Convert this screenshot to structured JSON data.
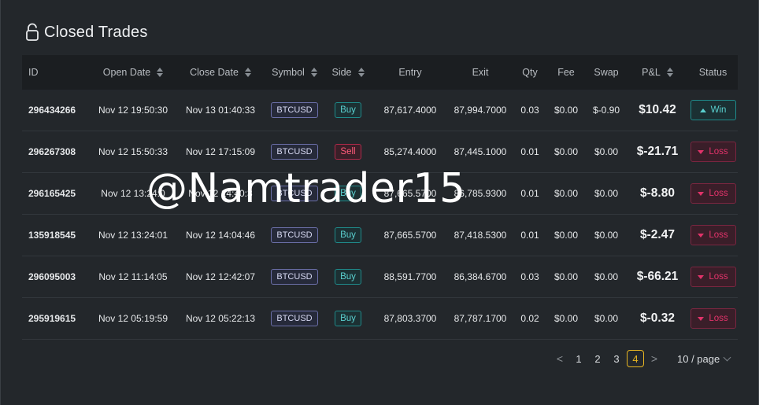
{
  "header": {
    "title": "Closed Trades",
    "icon": "lock-icon"
  },
  "table": {
    "columns": {
      "id": "ID",
      "open_date": "Open Date",
      "close_date": "Close Date",
      "symbol": "Symbol",
      "side": "Side",
      "entry": "Entry",
      "exit": "Exit",
      "qty": "Qty",
      "fee": "Fee",
      "swap": "Swap",
      "pnl": "P&L",
      "status": "Status"
    },
    "rows": [
      {
        "id": "296434266",
        "open_date": "Nov 12 19:50:30",
        "close_date": "Nov 13 01:40:33",
        "symbol": "BTCUSD",
        "side": "Buy",
        "entry": "87,617.4000",
        "exit": "87,994.7000",
        "qty": "0.03",
        "fee": "$0.00",
        "swap": "$-0.90",
        "pnl": "$10.42",
        "status": "Win"
      },
      {
        "id": "296267308",
        "open_date": "Nov 12 15:50:33",
        "close_date": "Nov 12 17:15:09",
        "symbol": "BTCUSD",
        "side": "Sell",
        "entry": "85,274.4000",
        "exit": "87,445.1000",
        "qty": "0.01",
        "fee": "$0.00",
        "swap": "$0.00",
        "pnl": "$-21.71",
        "status": "Loss"
      },
      {
        "id": "296165425",
        "open_date": "Nov 12 13:24:0",
        "close_date": "Nov 12 14:40:3",
        "symbol": "BTCUSD",
        "side": "Buy",
        "entry": "87,665.5700",
        "exit": "86,785.9300",
        "qty": "0.01",
        "fee": "$0.00",
        "swap": "$0.00",
        "pnl": "$-8.80",
        "status": "Loss"
      },
      {
        "id": "135918545",
        "open_date": "Nov 12 13:24:01",
        "close_date": "Nov 12 14:04:46",
        "symbol": "BTCUSD",
        "side": "Buy",
        "entry": "87,665.5700",
        "exit": "87,418.5300",
        "qty": "0.01",
        "fee": "$0.00",
        "swap": "$0.00",
        "pnl": "$-2.47",
        "status": "Loss"
      },
      {
        "id": "296095003",
        "open_date": "Nov 12 11:14:05",
        "close_date": "Nov 12 12:42:07",
        "symbol": "BTCUSD",
        "side": "Buy",
        "entry": "88,591.7700",
        "exit": "86,384.6700",
        "qty": "0.03",
        "fee": "$0.00",
        "swap": "$0.00",
        "pnl": "$-66.21",
        "status": "Loss"
      },
      {
        "id": "295919615",
        "open_date": "Nov 12 05:19:59",
        "close_date": "Nov 12 05:22:13",
        "symbol": "BTCUSD",
        "side": "Buy",
        "entry": "87,803.3700",
        "exit": "87,787.1700",
        "qty": "0.02",
        "fee": "$0.00",
        "swap": "$0.00",
        "pnl": "$-0.32",
        "status": "Loss"
      }
    ]
  },
  "pagination": {
    "prev": "<",
    "next": ">",
    "pages": [
      "1",
      "2",
      "3",
      "4"
    ],
    "current": "4",
    "page_size": "10 / page"
  },
  "watermark": "@Namtrader15",
  "colors": {
    "win": "#5ad0cf",
    "loss": "#e2336a",
    "active_page": "#e6b422"
  }
}
